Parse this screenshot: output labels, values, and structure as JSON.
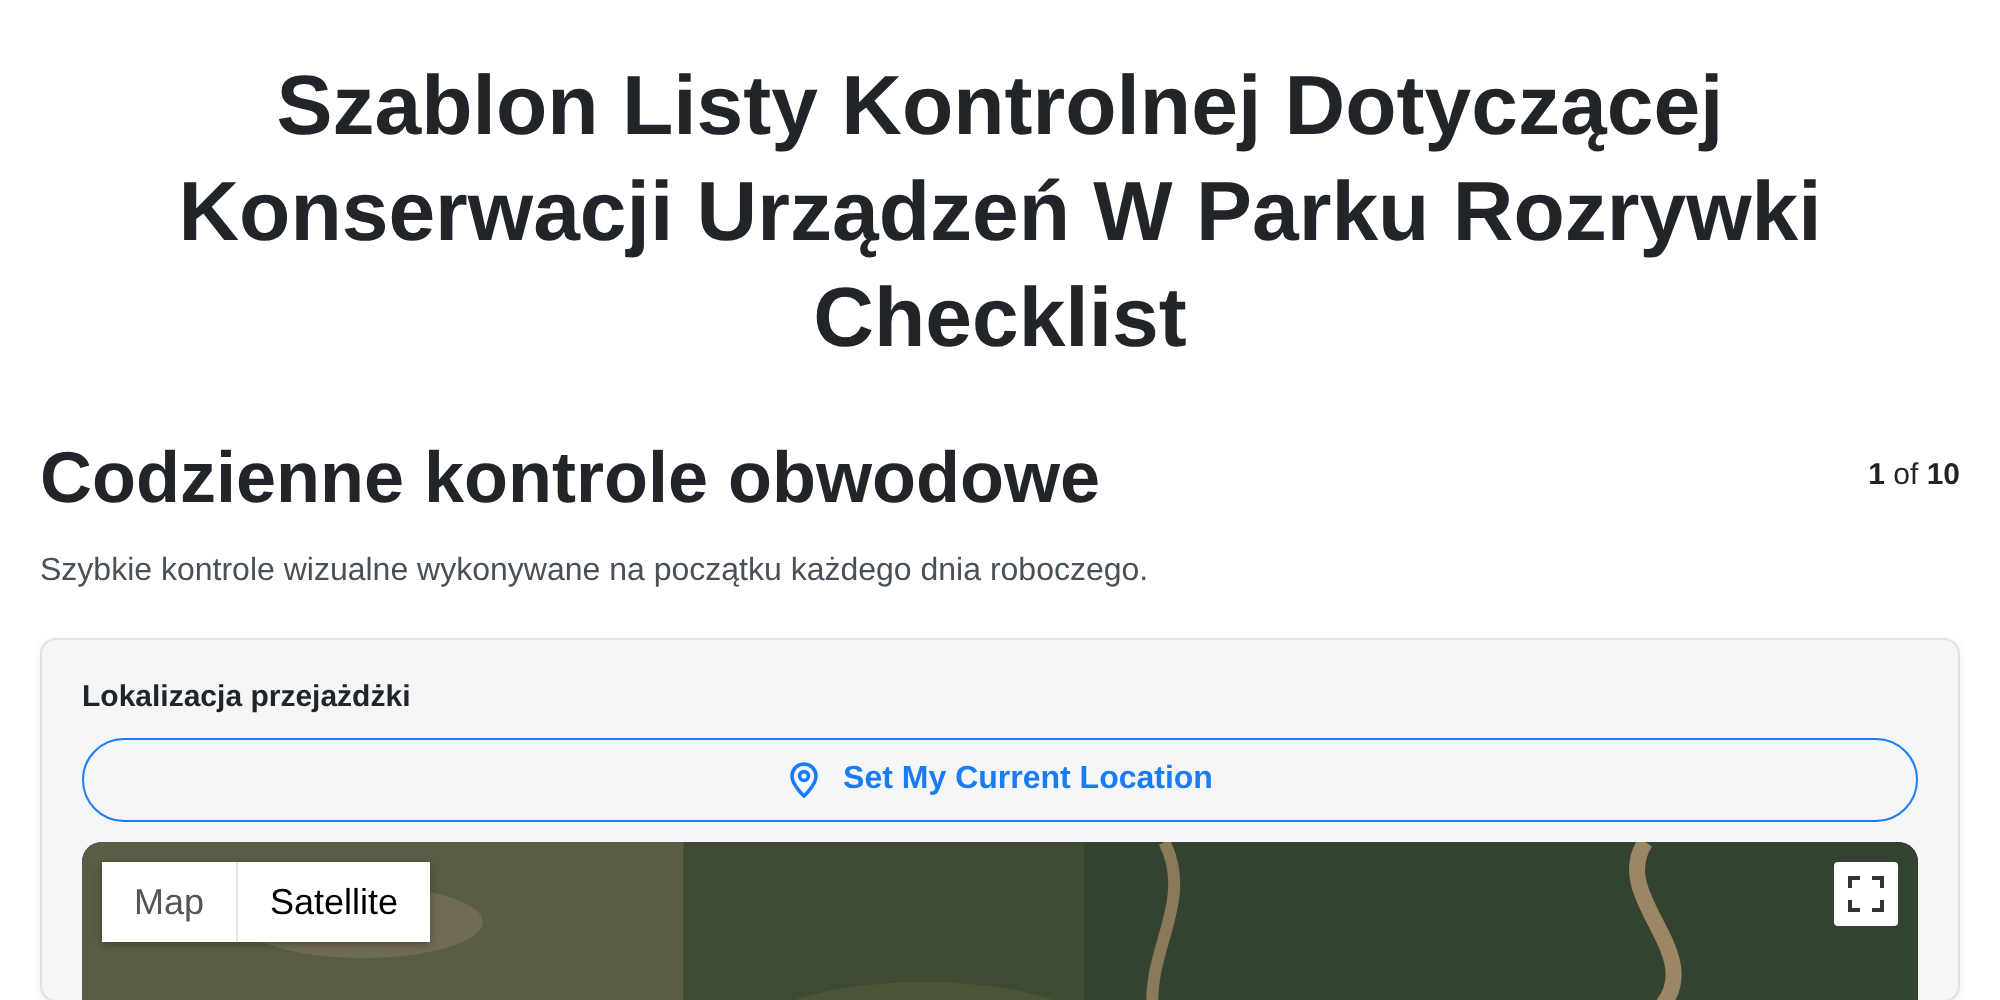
{
  "title": "Szablon Listy Kontrolnej Dotyczącej Konserwacji Urządzeń W Parku Rozrywki Checklist",
  "section": {
    "heading": "Codzienne kontrole obwodowe",
    "progress": "**1** of **10**",
    "description": "Szybkie kontrole wizualne wykonywane na początku każdego dnia roboczego."
  },
  "field": {
    "label": "Lokalizacja przejażdżki",
    "button": "Set My Current Location",
    "map": {
      "kind": "picture",
      "types": [
        {
          "label": "Map",
          "selected": false
        },
        {
          "label": "Satellite",
          "selected": true
        }
      ]
    }
  }
}
